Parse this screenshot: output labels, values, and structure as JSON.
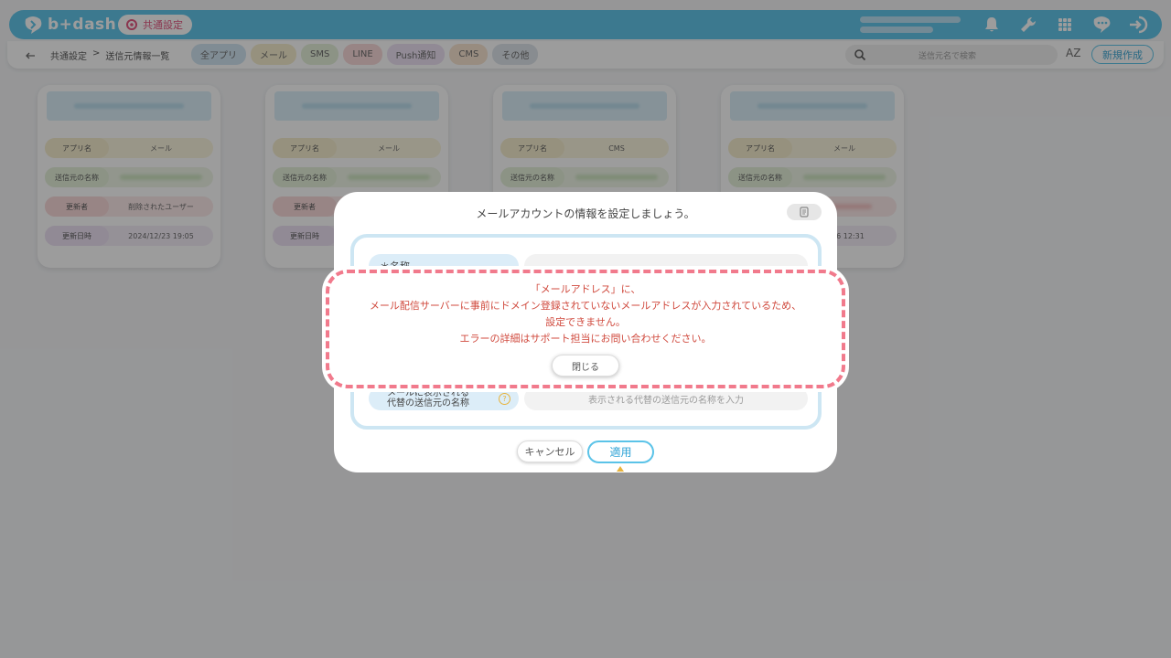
{
  "header": {
    "logo_text": "b+dash",
    "shared_badge": "共通設定",
    "icons": [
      "bell-icon",
      "wrench-icon",
      "grid-icon",
      "chat-icon",
      "logout-icon"
    ]
  },
  "subbar": {
    "breadcrumb": [
      "共通設定",
      ">",
      "送信元情報一覧"
    ],
    "tabs": [
      {
        "label": "全アプリ",
        "color": "#cfe3f1"
      },
      {
        "label": "メール",
        "color": "#f5eccb"
      },
      {
        "label": "SMS",
        "color": "#e3efd8"
      },
      {
        "label": "LINE",
        "color": "#f8d7d7"
      },
      {
        "label": "Push通知",
        "color": "#ece1f3"
      },
      {
        "label": "CMS",
        "color": "#f9e3cf"
      },
      {
        "label": "その他",
        "color": "#dde3ea"
      }
    ],
    "search_placeholder": "送信元名で検索",
    "sort_label": "AZ",
    "new_button": "新規作成"
  },
  "cards": [
    {
      "app_label": "アプリ名",
      "app_value": "メール",
      "sender_label": "送信元の名称",
      "updater_label": "更新者",
      "updater_value": "削除されたユーザー",
      "updated_label": "更新日時",
      "updated_value": "2024/12/23 19:05"
    },
    {
      "app_label": "アプリ名",
      "app_value": "メール",
      "sender_label": "送信元の名称",
      "updater_label": "更新者",
      "updater_value": "",
      "updated_label": "更新日時",
      "updated_value": ""
    },
    {
      "app_label": "アプリ名",
      "app_value": "CMS",
      "sender_label": "送信元の名称",
      "updater_label": "",
      "updater_value": "",
      "updated_label": "",
      "updated_value": ""
    },
    {
      "app_label": "アプリ名",
      "app_value": "メール",
      "sender_label": "送信元の名称",
      "updater_label": "",
      "updater_value": "",
      "updated_label": "",
      "updated_value": "0/16 12:31"
    }
  ],
  "modal": {
    "title": "メールアカウントの情報を設定しましょう。",
    "name_label": "＊名称",
    "alt_label_line1": "メールに表示される",
    "alt_label_line2": "代替の送信元の名称",
    "alt_placeholder": "表示される代替の送信元の名称を入力",
    "cancel": "キャンセル",
    "apply": "適用"
  },
  "error": {
    "line1": "「メールアドレス」に、",
    "line2": "メール配信サーバーに事前にドメイン登録されていないメールアドレスが入力されているため、",
    "line3": "設定できません。",
    "line4": "エラーの詳細はサポート担当にお問い合わせください。",
    "close": "閉じる"
  }
}
